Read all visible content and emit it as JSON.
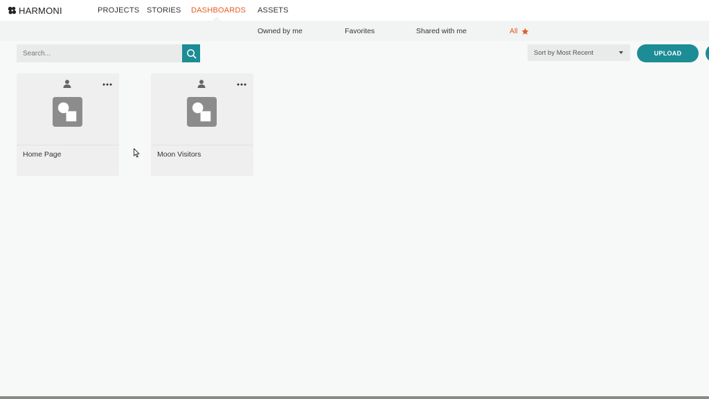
{
  "app": {
    "brand": "HARMONI",
    "logo_icon": "harmoni-flower-icon"
  },
  "nav": {
    "items": [
      {
        "label": "PROJECTS",
        "active": false
      },
      {
        "label": "STORIES",
        "active": false
      },
      {
        "label": "DASHBOARDS",
        "active": true
      },
      {
        "label": "ASSETS",
        "active": false
      }
    ]
  },
  "subnav": {
    "items": [
      {
        "label": "Owned by me",
        "active": false
      },
      {
        "label": "Favorites",
        "active": false
      },
      {
        "label": "Shared with me",
        "active": false
      },
      {
        "label": "All",
        "active": true,
        "icon": "star-icon"
      }
    ]
  },
  "search": {
    "placeholder": "Search...",
    "value": "",
    "icon": "search-icon"
  },
  "sort": {
    "selected": "Sort by Most Recent"
  },
  "toolbar": {
    "upload_label": "UPLOAD"
  },
  "cards": [
    {
      "title": "Home Page",
      "owner_icon": "user-icon",
      "menu_icon": "more-options-icon",
      "preview_icon": "dashboard-placeholder-icon"
    },
    {
      "title": "Moon Visitors",
      "owner_icon": "user-icon",
      "menu_icon": "more-options-icon",
      "preview_icon": "dashboard-placeholder-icon"
    }
  ],
  "colors": {
    "accent": "#1c8c95",
    "active_nav": "#e35b1f",
    "background": "#f7f8f8",
    "card": "#efefef",
    "icon_gray": "#8c8c8c"
  }
}
